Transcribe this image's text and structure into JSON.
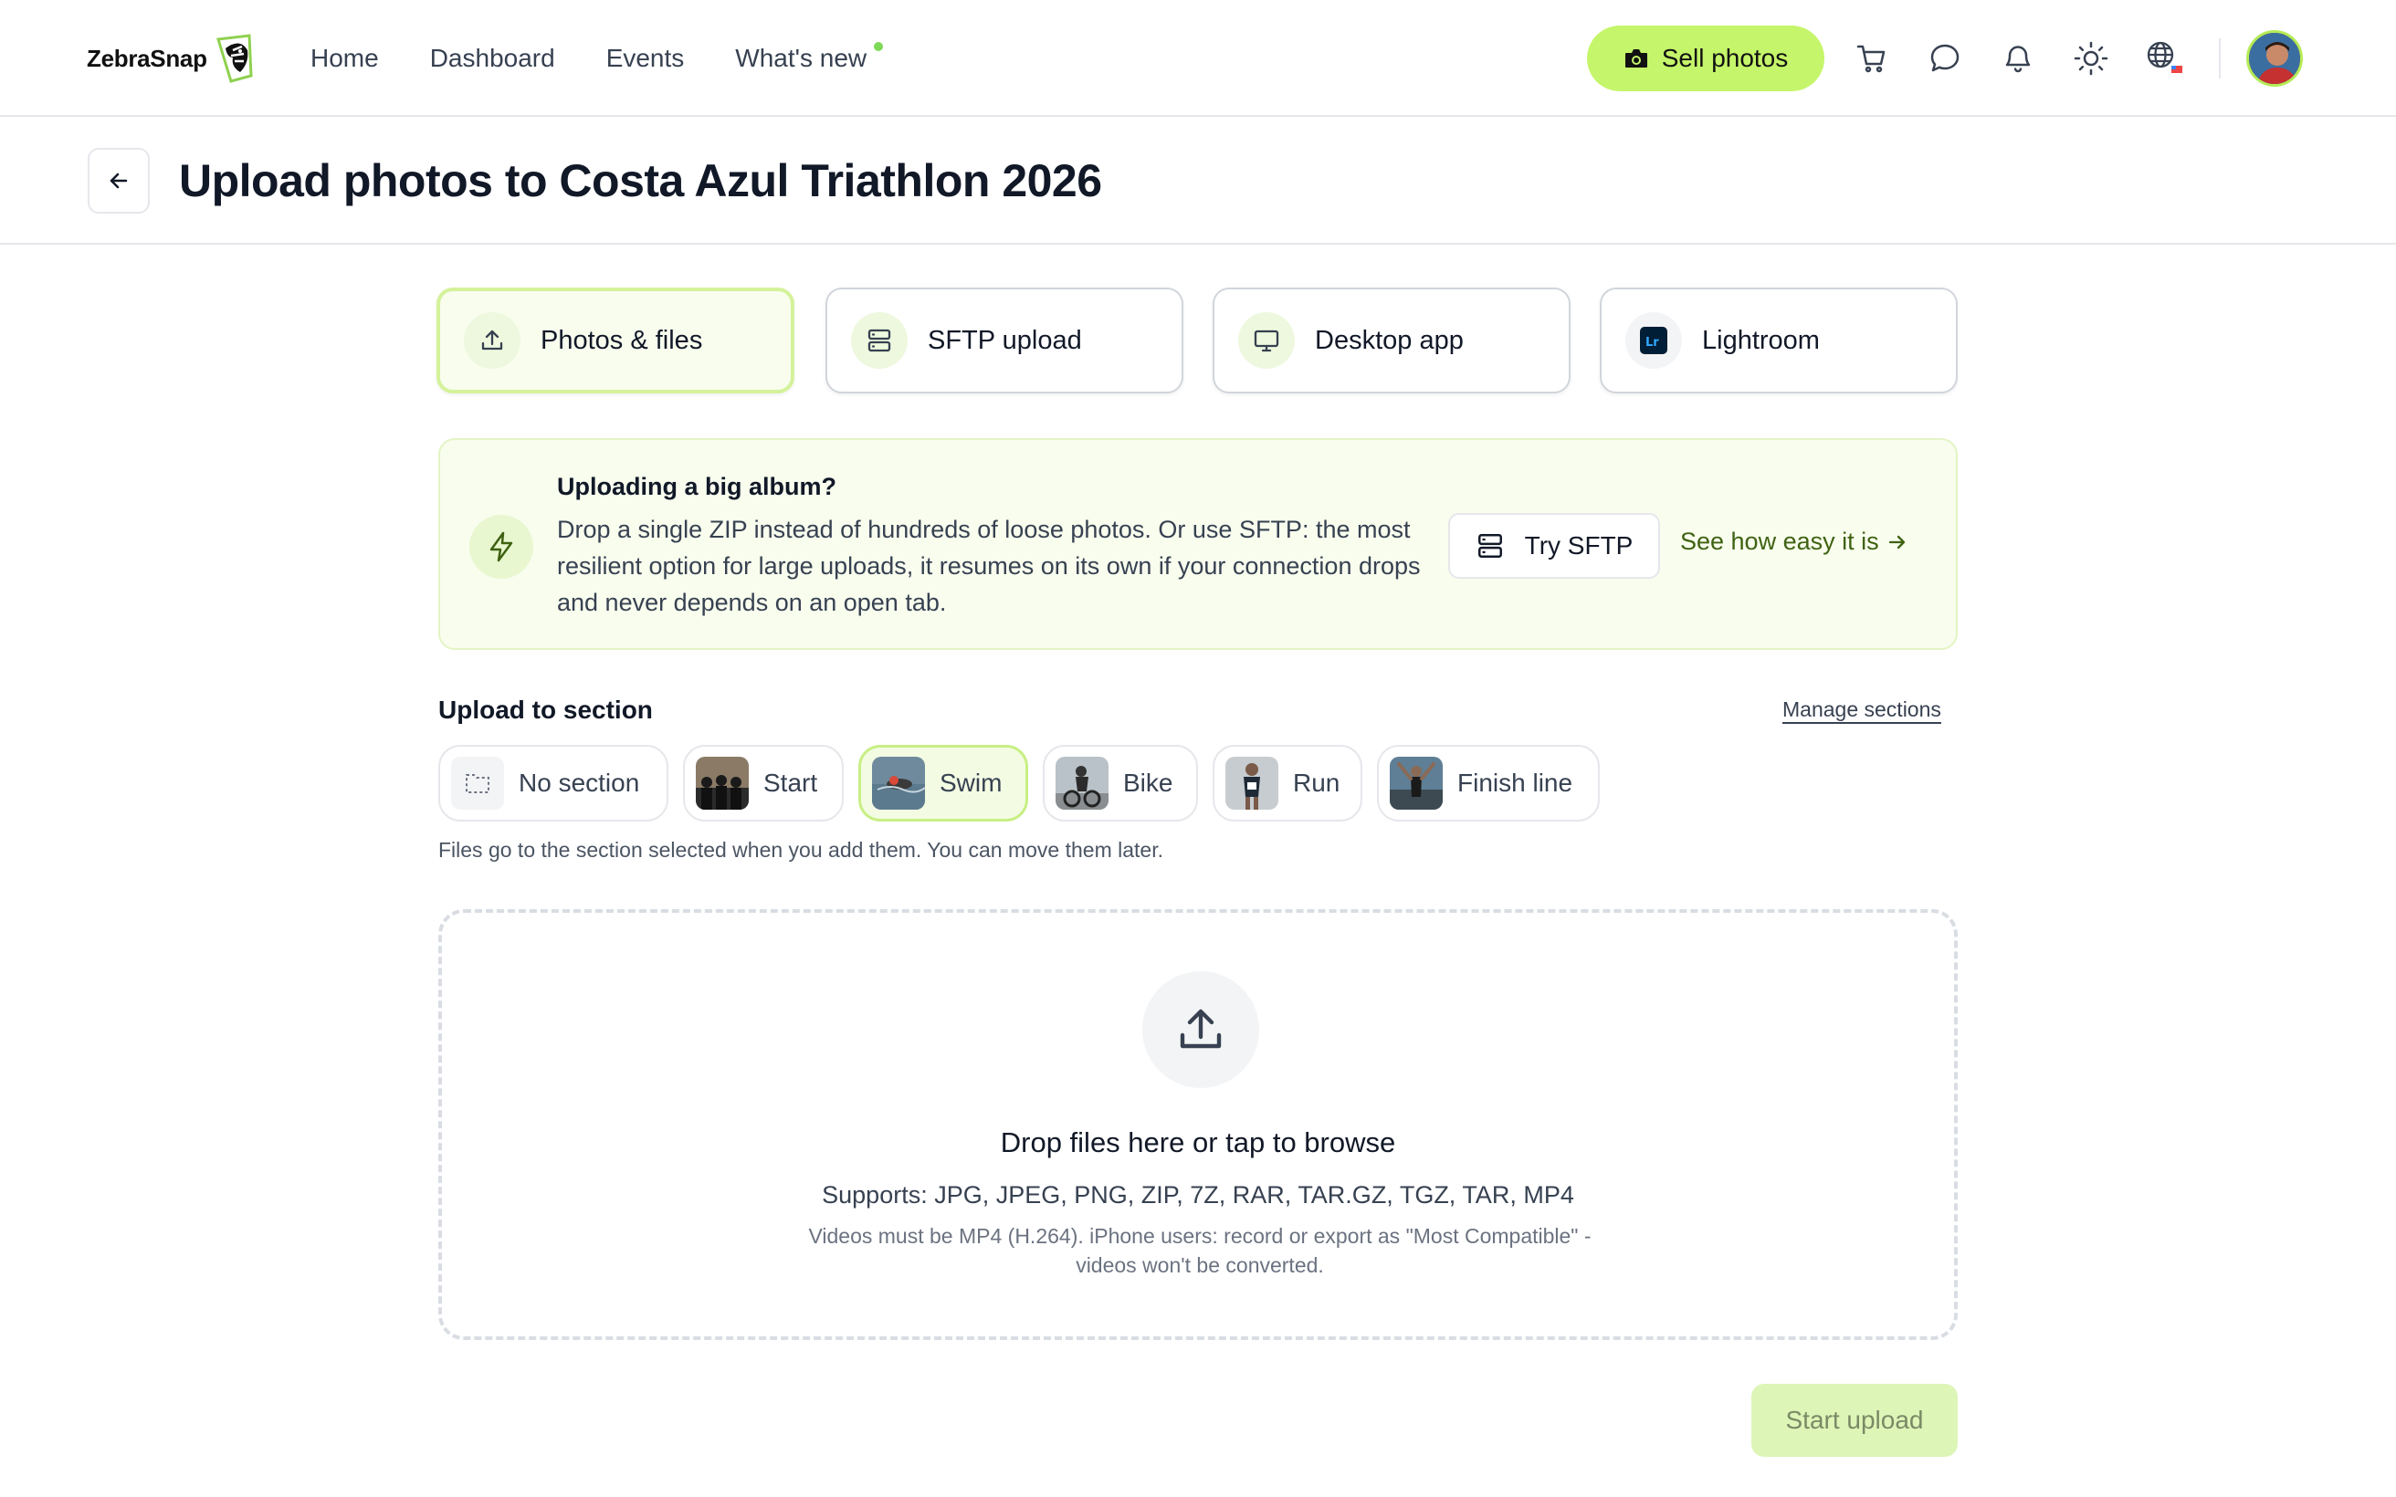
{
  "brand": {
    "name": "ZebraSnap",
    "accent": "#c5f56a",
    "accent_dot": "#7ed957"
  },
  "nav": {
    "items": [
      {
        "label": "Home"
      },
      {
        "label": "Dashboard"
      },
      {
        "label": "Events"
      },
      {
        "label": "What's new",
        "has_dot": true
      }
    ],
    "sell_label": "Sell photos",
    "icons": [
      "cart-icon",
      "chat-icon",
      "bell-icon",
      "sun-icon",
      "globe-icon"
    ]
  },
  "page": {
    "title": "Upload photos to Costa Azul Triathlon 2026"
  },
  "methods": [
    {
      "label": "Photos & files",
      "icon": "upload-icon",
      "active": true
    },
    {
      "label": "SFTP upload",
      "icon": "server-icon",
      "active": false
    },
    {
      "label": "Desktop app",
      "icon": "monitor-icon",
      "active": false
    },
    {
      "label": "Lightroom",
      "icon": "lightroom-icon",
      "active": false
    }
  ],
  "tip": {
    "title": "Uploading a big album?",
    "body": "Drop a single ZIP instead of hundreds of loose photos. Or use SFTP: the most resilient option for large uploads, it resumes on its own if your connection drops and never depends on an open tab.",
    "try_label": "Try SFTP",
    "see_label": "See how easy it is"
  },
  "sections": {
    "label": "Upload to section",
    "manage_label": "Manage sections",
    "chips": [
      {
        "label": "No section",
        "active": false
      },
      {
        "label": "Start",
        "active": false
      },
      {
        "label": "Swim",
        "active": true
      },
      {
        "label": "Bike",
        "active": false
      },
      {
        "label": "Run",
        "active": false
      },
      {
        "label": "Finish line",
        "active": false
      }
    ],
    "helper": "Files go to the section selected when you add them. You can move them later."
  },
  "dropzone": {
    "title": "Drop files here or tap to browse",
    "supports": "Supports: JPG, JPEG, PNG, ZIP, 7Z, RAR, TAR.GZ, TGZ, TAR, MP4",
    "note": "Videos must be MP4 (H.264). iPhone users: record or export as \"Most Compatible\" - videos won't be converted."
  },
  "actions": {
    "start_label": "Start upload"
  }
}
